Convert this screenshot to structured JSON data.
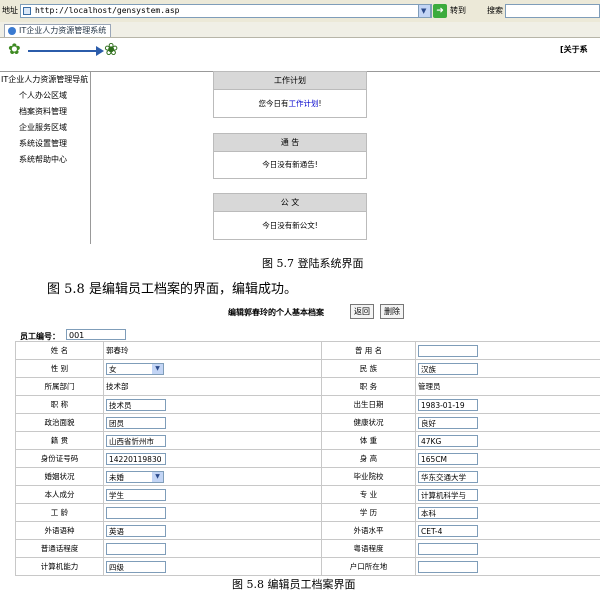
{
  "browser": {
    "address_label": "地址",
    "url": "http://localhost/gensystem.asp",
    "go_label": "转到",
    "search_label": "搜索",
    "tab_title": "IT企业人力资源管理系统"
  },
  "site": {
    "about_link": "[关于系"
  },
  "nav": {
    "title": "IT企业人力资源管理导航",
    "items": [
      {
        "label": "个人办公区域"
      },
      {
        "label": "档案资料管理"
      },
      {
        "label": "企业服务区域"
      },
      {
        "label": "系统设置管理"
      },
      {
        "label": "系统帮助中心"
      }
    ]
  },
  "panels": {
    "plan": {
      "title": "工作计划",
      "text_before": "您今日有",
      "link": "工作计划",
      "text_after": "!"
    },
    "notice": {
      "title": "通 告",
      "text": "今日没有新通告!"
    },
    "docs": {
      "title": "公 文",
      "text": "今日没有新公文!"
    }
  },
  "captions": {
    "fig57": "图 5.7  登陆系统界面",
    "body": "图 5.8 是编辑员工档案的界面，编辑成功。",
    "fig58": "图 5.8  编辑员工档案界面"
  },
  "form": {
    "title": "编辑郭春玲的个人基本档案",
    "back_button": "返回",
    "delete_button": "删除",
    "empno_label": "员工编号：",
    "empno_value": "001",
    "rows": [
      {
        "l1": "姓 名",
        "v1": "郭春玲",
        "t1": "text",
        "l2": "曾 用 名",
        "v2": "",
        "t2": "input"
      },
      {
        "l1": "性 别",
        "v1": "女",
        "t1": "select",
        "l2": "民 族",
        "v2": "汉族",
        "t2": "input"
      },
      {
        "l1": "所属部门",
        "v1": "技术部",
        "t1": "text",
        "l2": "职 务",
        "v2": "管理员",
        "t2": "text"
      },
      {
        "l1": "职 称",
        "v1": "技术员",
        "t1": "input",
        "l2": "出生日期",
        "v2": "1983-01-19",
        "t2": "input"
      },
      {
        "l1": "政治面貌",
        "v1": "团员",
        "t1": "input",
        "l2": "健康状况",
        "v2": "良好",
        "t2": "input"
      },
      {
        "l1": "籍 贯",
        "v1": "山西省忻州市",
        "t1": "input",
        "l2": "体 重",
        "v2": "47KG",
        "t2": "input"
      },
      {
        "l1": "身份证号码",
        "v1": "14220119830",
        "t1": "input",
        "l2": "身 高",
        "v2": "165CM",
        "t2": "input"
      },
      {
        "l1": "婚姻状况",
        "v1": "未婚",
        "t1": "select",
        "l2": "毕业院校",
        "v2": "华东交通大学",
        "t2": "input"
      },
      {
        "l1": "本人成分",
        "v1": "学生",
        "t1": "input",
        "l2": "专 业",
        "v2": "计算机科学与",
        "t2": "input"
      },
      {
        "l1": "工 龄",
        "v1": "",
        "t1": "input",
        "l2": "学 历",
        "v2": "本科",
        "t2": "input"
      },
      {
        "l1": "外语语种",
        "v1": "英语",
        "t1": "input",
        "l2": "外语水平",
        "v2": "CET-4",
        "t2": "input"
      },
      {
        "l1": "普通话程度",
        "v1": "",
        "t1": "input",
        "l2": "粤语程度",
        "v2": "",
        "t2": "input"
      },
      {
        "l1": "计算机能力",
        "v1": "四级",
        "t1": "input",
        "l2": "户口所在地",
        "v2": "",
        "t2": "input"
      }
    ]
  },
  "colors": {
    "link": "#0000cc",
    "panel_header": "#d8d8d8",
    "input_border": "#7f9db9"
  }
}
